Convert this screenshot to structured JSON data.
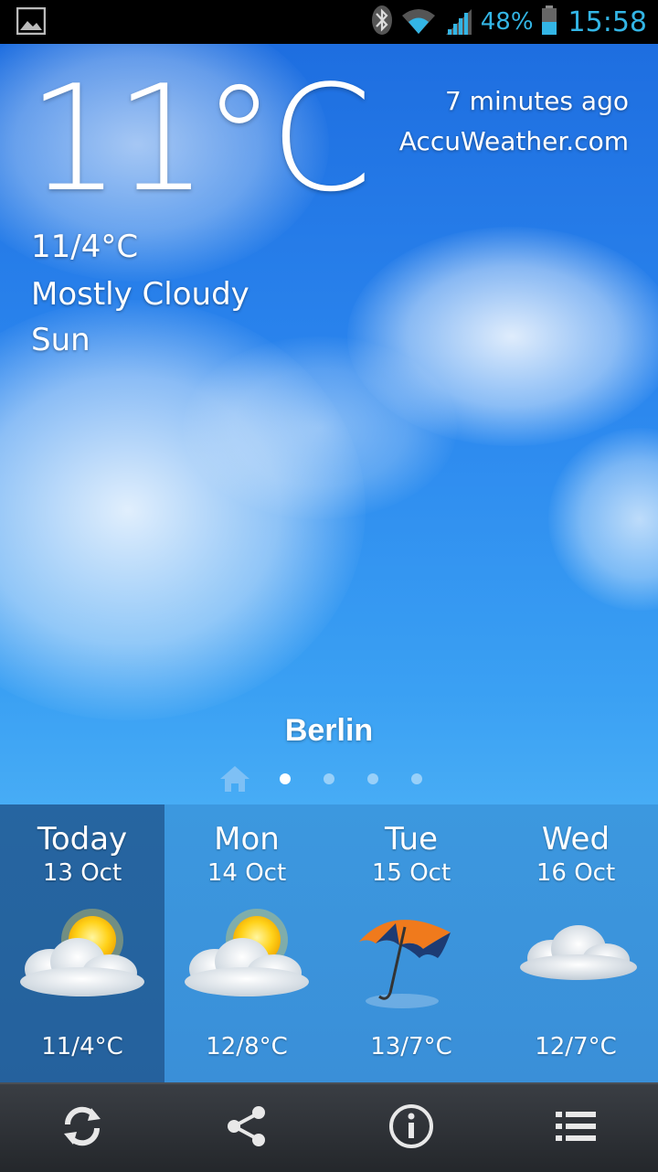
{
  "status_bar": {
    "battery_percent": "48%",
    "time": "15:58",
    "icons": [
      "gallery-icon",
      "bluetooth-icon",
      "wifi-icon",
      "signal-icon",
      "battery-icon"
    ]
  },
  "current": {
    "temperature": "11°C",
    "hi_lo": "11/4°C",
    "condition": "Mostly Cloudy",
    "day": "Sun",
    "updated": "7 minutes ago",
    "provider": "AccuWeather.com"
  },
  "location": {
    "city": "Berlin",
    "page_count": 4,
    "active_page": 0
  },
  "forecast": [
    {
      "day": "Today",
      "date": "13 Oct",
      "temp": "11/4°C",
      "icon": "partly-sunny-icon",
      "selected": true
    },
    {
      "day": "Mon",
      "date": "14 Oct",
      "temp": "12/8°C",
      "icon": "partly-sunny-icon",
      "selected": false
    },
    {
      "day": "Tue",
      "date": "15 Oct",
      "temp": "13/7°C",
      "icon": "umbrella-rain-icon",
      "selected": false
    },
    {
      "day": "Wed",
      "date": "16 Oct",
      "temp": "12/7°C",
      "icon": "cloudy-icon",
      "selected": false
    }
  ],
  "toolbar": {
    "buttons": [
      "refresh-icon",
      "share-icon",
      "info-icon",
      "list-icon"
    ]
  },
  "colors": {
    "status_accent": "#33b5e5",
    "sky_top": "#1e6ee0",
    "sky_bottom": "#47acf5",
    "toolbar": "#2b2e33"
  }
}
